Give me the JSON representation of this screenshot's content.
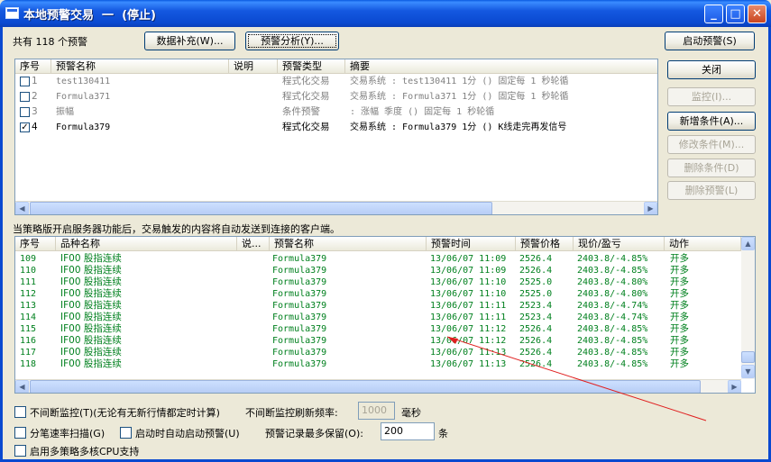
{
  "window": {
    "title": "本地预警交易  一  (停止)",
    "minimize_glyph": "_",
    "maximize_glyph": "□",
    "close_glyph": "✕"
  },
  "top": {
    "count_label": "共有 118 个预警",
    "supplement_button": "数据补充(W)...",
    "analysis_button": "预警分析(Y)...",
    "start_button": "启动预警(S)"
  },
  "side_buttons": {
    "close": "关闭",
    "monitor": "监控(I)...",
    "add_condition": "新增条件(A)...",
    "edit_condition": "修改条件(M)...",
    "delete_condition": "删除条件(D)",
    "delete_alert": "删除预警(L)"
  },
  "alerts": {
    "columns": [
      "序号",
      "预警名称",
      "说明",
      "预警类型",
      "摘要"
    ],
    "rows": [
      {
        "num": "1",
        "name": "test130411",
        "desc": "",
        "type": "程式化交易",
        "summary": "交易系统 : test130411 1分 () 固定每 1 秒轮循",
        "checked": false,
        "muted": true
      },
      {
        "num": "2",
        "name": "Formula371",
        "desc": "",
        "type": "程式化交易",
        "summary": "交易系统 : Formula371 1分 () 固定每 1 秒轮循",
        "checked": false,
        "muted": true
      },
      {
        "num": "3",
        "name": "振幅",
        "desc": "",
        "type": "条件预警",
        "summary": " : 涨幅 季度 () 固定每 1 秒轮循",
        "checked": false,
        "muted": true
      },
      {
        "num": "4",
        "name": "Formula379",
        "desc": "",
        "type": "程式化交易",
        "summary": "交易系统 : Formula379 1分 () K线走完再发信号",
        "checked": true,
        "muted": false
      }
    ]
  },
  "server_note": "当策略版开启服务器功能后，交易触发的内容将自动发送到连接的客户端。",
  "triggers": {
    "columns": [
      "序号",
      "品种名称",
      "说...",
      "预警名称",
      "预警时间",
      "预警价格",
      "现价/盈亏",
      "动作"
    ],
    "rows": [
      {
        "num": "109",
        "product": "IF00 股指连续",
        "note": "",
        "alert": "Formula379",
        "time": "13/06/07 11:09",
        "price": "2526.4",
        "pnl": "2403.8/-4.85%",
        "action": "开多"
      },
      {
        "num": "110",
        "product": "IF00 股指连续",
        "note": "",
        "alert": "Formula379",
        "time": "13/06/07 11:09",
        "price": "2526.4",
        "pnl": "2403.8/-4.85%",
        "action": "开多"
      },
      {
        "num": "111",
        "product": "IF00 股指连续",
        "note": "",
        "alert": "Formula379",
        "time": "13/06/07 11:10",
        "price": "2525.0",
        "pnl": "2403.8/-4.80%",
        "action": "开多"
      },
      {
        "num": "112",
        "product": "IF00 股指连续",
        "note": "",
        "alert": "Formula379",
        "time": "13/06/07 11:10",
        "price": "2525.0",
        "pnl": "2403.8/-4.80%",
        "action": "开多"
      },
      {
        "num": "113",
        "product": "IF00 股指连续",
        "note": "",
        "alert": "Formula379",
        "time": "13/06/07 11:11",
        "price": "2523.4",
        "pnl": "2403.8/-4.74%",
        "action": "开多"
      },
      {
        "num": "114",
        "product": "IF00 股指连续",
        "note": "",
        "alert": "Formula379",
        "time": "13/06/07 11:11",
        "price": "2523.4",
        "pnl": "2403.8/-4.74%",
        "action": "开多"
      },
      {
        "num": "115",
        "product": "IF00 股指连续",
        "note": "",
        "alert": "Formula379",
        "time": "13/06/07 11:12",
        "price": "2526.4",
        "pnl": "2403.8/-4.85%",
        "action": "开多"
      },
      {
        "num": "116",
        "product": "IF00 股指连续",
        "note": "",
        "alert": "Formula379",
        "time": "13/06/07 11:12",
        "price": "2526.4",
        "pnl": "2403.8/-4.85%",
        "action": "开多"
      },
      {
        "num": "117",
        "product": "IF00 股指连续",
        "note": "",
        "alert": "Formula379",
        "time": "13/06/07 11:13",
        "price": "2526.4",
        "pnl": "2403.8/-4.85%",
        "action": "开多"
      },
      {
        "num": "118",
        "product": "IF00 股指连续",
        "note": "",
        "alert": "Formula379",
        "time": "13/06/07 11:13",
        "price": "2526.4",
        "pnl": "2403.8/-4.85%",
        "action": "开多"
      }
    ]
  },
  "options": {
    "continuous_label": "不间断监控(T)(无论有无新行情都定时计算)",
    "refresh_label": "不间断监控刷新频率:",
    "refresh_value": "1000",
    "refresh_unit": "毫秒",
    "tick_scan_label": "分笔速率扫描(G)",
    "autostart_label": "启动时自动启动预警(U)",
    "max_keep_label": "预警记录最多保留(O):",
    "max_keep_value": "200",
    "max_keep_unit": "条",
    "multicore_label": "启用多策略多核CPU支持"
  },
  "colors": {
    "trigger_text": "#00801e",
    "annotation_arrow": "#e02020"
  }
}
